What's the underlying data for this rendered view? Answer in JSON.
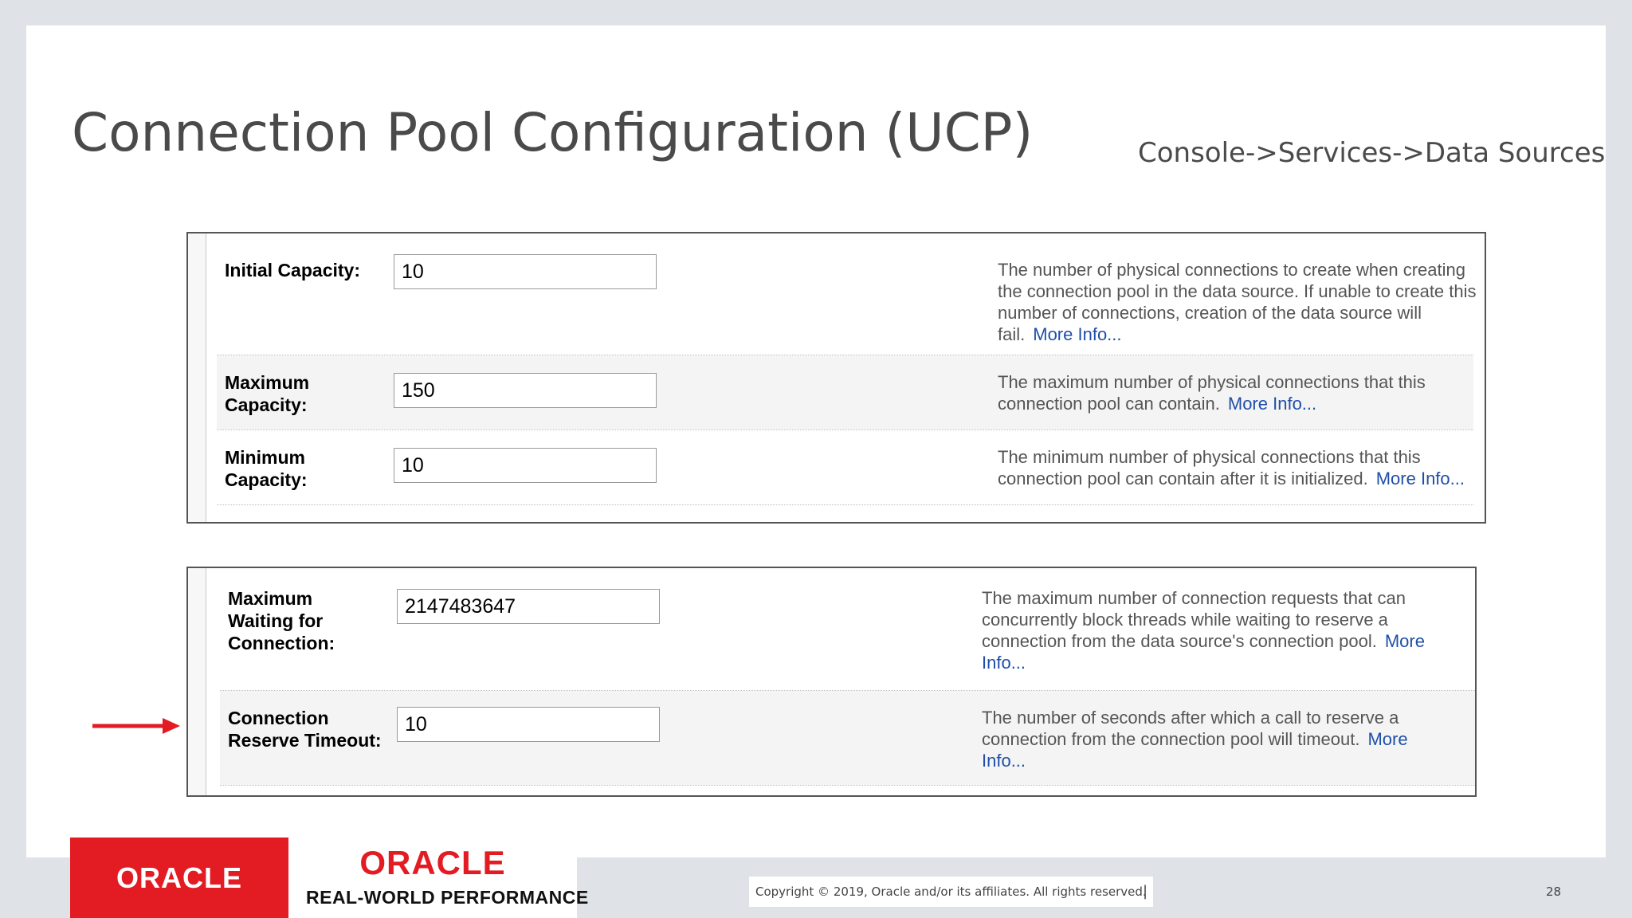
{
  "slide": {
    "title": "Connection Pool Configuration (UCP)",
    "subtitle": "Console->Services->Data Sources"
  },
  "panel1": {
    "rows": [
      {
        "label": "Initial Capacity:",
        "value": "10",
        "description": "The number of physical connections to create when creating the connection pool in the data source. If unable to create this number of connections, creation of the data source will fail.",
        "more": "More Info..."
      },
      {
        "label": "Maximum Capacity:",
        "value": "150",
        "description": "The maximum number of physical connections that this connection pool can contain.",
        "more": "More Info..."
      },
      {
        "label": "Minimum Capacity:",
        "value": "10",
        "description": "The minimum number of physical connections that this connection pool can contain after it is initialized.",
        "more": "More Info..."
      }
    ]
  },
  "panel2": {
    "rows": [
      {
        "label": "Maximum Waiting for Connection:",
        "value": "2147483647",
        "description": "The maximum number of connection requests that can concurrently block threads while waiting to reserve a connection from the data source's connection pool.",
        "more": "More Info..."
      },
      {
        "label": "Connection Reserve Timeout:",
        "value": "10",
        "description": "The number of seconds after which a call to reserve a connection from the connection pool will timeout.",
        "more": "More Info..."
      }
    ]
  },
  "footer": {
    "oracle_logo": "ORACLE",
    "rwp_logo_word": "ORACLE",
    "rwp_tagline": "REAL-WORLD PERFORMANCE",
    "copyright": "Copyright © 2019, Oracle and/or its affiliates. All rights reserved.",
    "separator": "|",
    "page_number": "28"
  },
  "colors": {
    "oracle_red": "#e31b23",
    "link_blue": "#1f4fa8",
    "arrow_red": "#e31b23"
  }
}
